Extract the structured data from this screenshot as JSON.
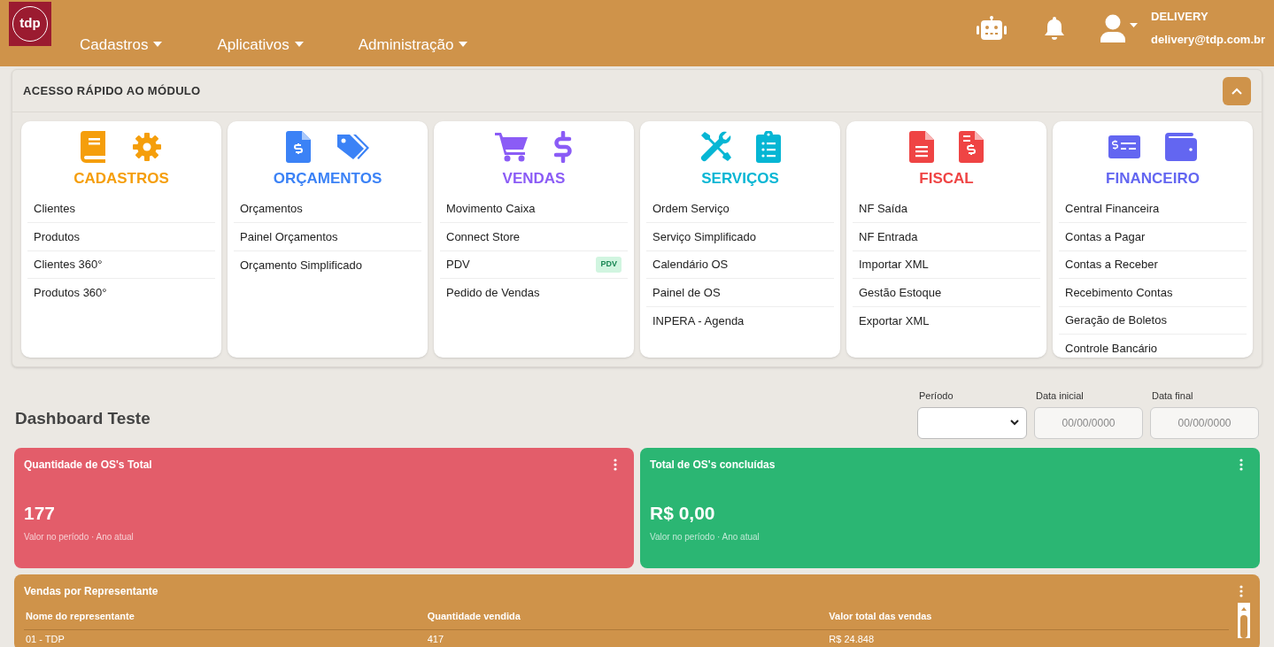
{
  "navbar": {
    "logo": "tdp",
    "menus": [
      {
        "label": "Cadastros"
      },
      {
        "label": "Aplicativos"
      },
      {
        "label": "Administração"
      }
    ],
    "user": {
      "name": "DELIVERY",
      "email": "delivery@tdp.com.br"
    }
  },
  "quick_access": {
    "title": "ACESSO RÁPIDO AO MÓDULO",
    "expanded": true,
    "modules": [
      {
        "title": "CADASTROS",
        "color": "#f59e0b",
        "items": [
          {
            "label": "Clientes"
          },
          {
            "label": "Produtos"
          },
          {
            "label": "Clientes 360°"
          },
          {
            "label": "Produtos 360°"
          }
        ]
      },
      {
        "title": "ORÇAMENTOS",
        "color": "#3b82f6",
        "items": [
          {
            "label": "Orçamentos"
          },
          {
            "label": "Painel Orçamentos"
          },
          {
            "label": "Orçamento Simplificado"
          }
        ]
      },
      {
        "title": "VENDAS",
        "color": "#8b5cf6",
        "items": [
          {
            "label": "Movimento Caixa"
          },
          {
            "label": "Connect Store"
          },
          {
            "label": "PDV",
            "badge": "PDV"
          },
          {
            "label": "Pedido de Vendas"
          }
        ]
      },
      {
        "title": "SERVIÇOS",
        "color": "#06b6d4",
        "items": [
          {
            "label": "Ordem Serviço"
          },
          {
            "label": "Serviço Simplificado"
          },
          {
            "label": "Calendário OS"
          },
          {
            "label": "Painel de OS"
          },
          {
            "label": "INPERA - Agenda"
          }
        ]
      },
      {
        "title": "FISCAL",
        "color": "#ef4444",
        "items": [
          {
            "label": "NF Saída"
          },
          {
            "label": "NF Entrada"
          },
          {
            "label": "Importar XML"
          },
          {
            "label": "Gestão Estoque"
          },
          {
            "label": "Exportar XML"
          }
        ]
      },
      {
        "title": "FINANCEIRO",
        "color": "#6366f1",
        "items": [
          {
            "label": "Central Financeira"
          },
          {
            "label": "Contas a Pagar"
          },
          {
            "label": "Contas a Receber"
          },
          {
            "label": "Recebimento Contas"
          },
          {
            "label": "Geração de Boletos"
          },
          {
            "label": "Controle Bancário"
          }
        ]
      }
    ]
  },
  "dashboard": {
    "title": "Dashboard Teste",
    "filters": [
      {
        "kind": "select",
        "label": "Período"
      },
      {
        "kind": "date",
        "label": "Data inicial",
        "placeholder": "00/00/0000"
      },
      {
        "kind": "date",
        "label": "Data final",
        "placeholder": "00/00/0000"
      }
    ],
    "cards": [
      {
        "title": "Quantidade de OS's Total",
        "value": "177",
        "caption": "Valor no período · Ano atual",
        "color": "#e35d6a"
      },
      {
        "title": "Total de OS's concluídas",
        "value": "R$ 0,00",
        "caption": "Valor no período · Ano atual",
        "color": "#2bb673"
      }
    ],
    "table": {
      "title": "Vendas por Representante",
      "columns": [
        "Nome do representante",
        "Quantidade vendida",
        "Valor total das vendas"
      ],
      "rows": [
        [
          "01 - TDP",
          "417",
          "R$ 24.848"
        ]
      ]
    }
  }
}
